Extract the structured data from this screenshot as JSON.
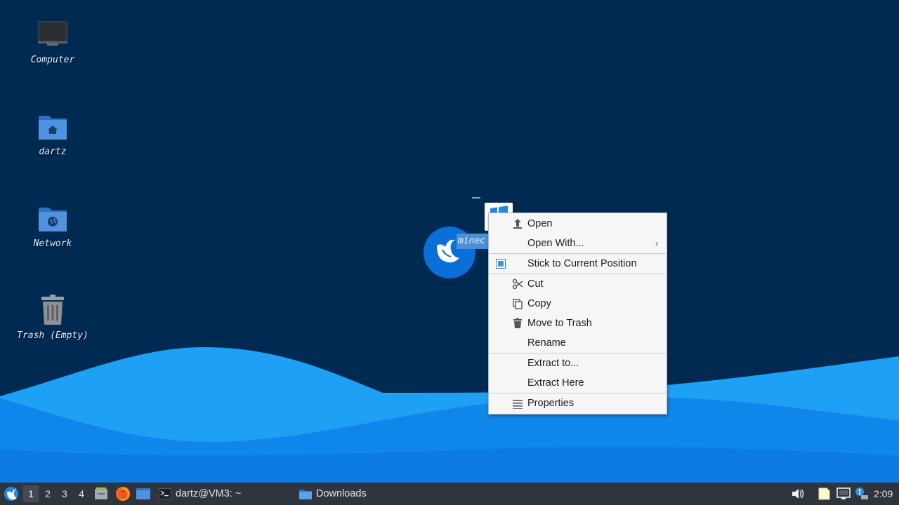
{
  "desktop": {
    "icons": [
      {
        "label": "Computer"
      },
      {
        "label": "dartz"
      },
      {
        "label": "Network"
      },
      {
        "label": "Trash (Empty)"
      }
    ],
    "selected_file": {
      "label": "minec"
    }
  },
  "context_menu": {
    "items": {
      "open": "Open",
      "open_with": "Open With...",
      "stick": "Stick to Current Position",
      "cut": "Cut",
      "copy": "Copy",
      "move_to_trash": "Move to Trash",
      "rename": "Rename",
      "extract_to": "Extract to...",
      "extract_here": "Extract Here",
      "properties": "Properties"
    },
    "stick_checked": true
  },
  "taskbar": {
    "workspaces": [
      "1",
      "2",
      "3",
      "4"
    ],
    "active_workspace": "1",
    "tasks": {
      "terminal": "dartz@VM3: ~",
      "downloads": "Downloads"
    },
    "clock": "2:09"
  },
  "colors": {
    "desktop_bg": "#012a52",
    "wave_light": "#1ea0f5",
    "wave_mid": "#0f86ea",
    "wave_deep": "#0a6fd8",
    "taskbar_bg": "#2f343f",
    "menu_bg": "#f6f6f6",
    "selection": "#4a90d9"
  }
}
